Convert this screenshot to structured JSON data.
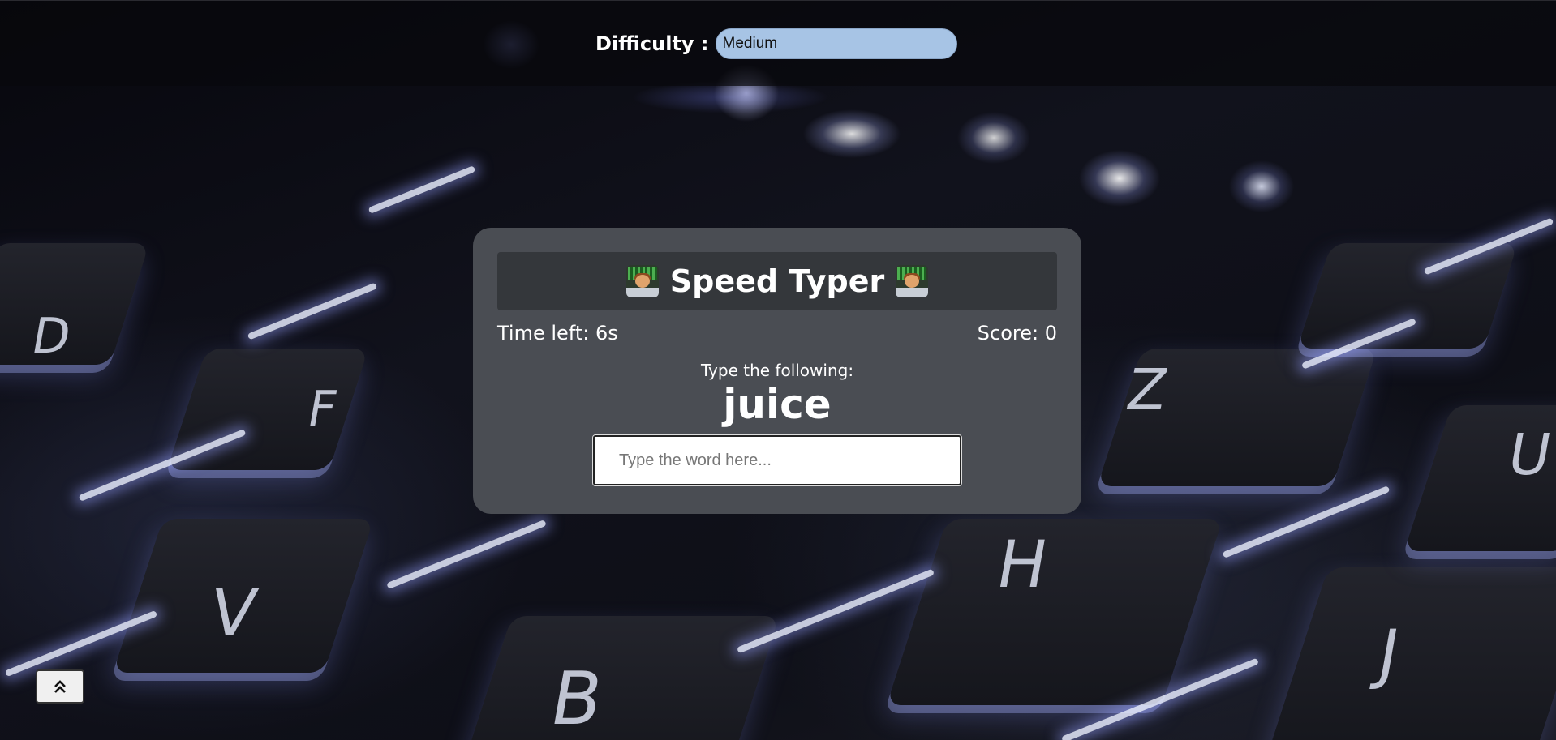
{
  "header": {
    "difficulty_label": "Difficulty :",
    "difficulty_selected": "Medium"
  },
  "game": {
    "title": "Speed Typer",
    "title_icon": "technologist-emoji-icon",
    "time_left": "Time left: 6s",
    "score": "Score: 0",
    "prompt": "Type the following:",
    "word": "juice",
    "input_value": "",
    "input_placeholder": "Type the word here..."
  },
  "footer": {
    "scroll_top_icon": "double-chevron-up-icon"
  },
  "background": {
    "key_labels": [
      "D",
      "F",
      "Z",
      "V",
      "H",
      "B",
      "J",
      "U"
    ]
  },
  "colors": {
    "card": "#4a4d53",
    "title_bar": "#34373b",
    "select_bg": "#a7c4e5"
  }
}
